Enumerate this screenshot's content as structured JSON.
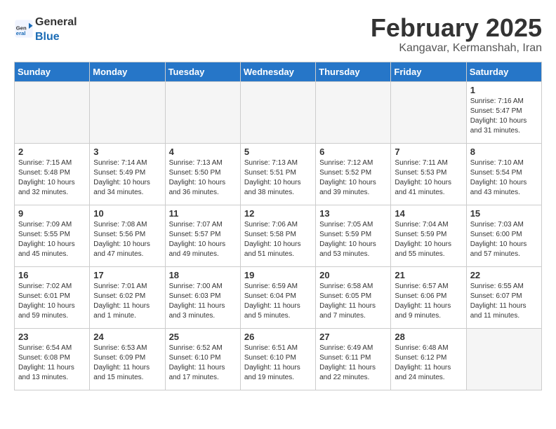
{
  "header": {
    "logo_general": "General",
    "logo_blue": "Blue",
    "month_year": "February 2025",
    "location": "Kangavar, Kermanshah, Iran"
  },
  "weekdays": [
    "Sunday",
    "Monday",
    "Tuesday",
    "Wednesday",
    "Thursday",
    "Friday",
    "Saturday"
  ],
  "weeks": [
    [
      {
        "day": "",
        "info": ""
      },
      {
        "day": "",
        "info": ""
      },
      {
        "day": "",
        "info": ""
      },
      {
        "day": "",
        "info": ""
      },
      {
        "day": "",
        "info": ""
      },
      {
        "day": "",
        "info": ""
      },
      {
        "day": "1",
        "info": "Sunrise: 7:16 AM\nSunset: 5:47 PM\nDaylight: 10 hours and 31 minutes."
      }
    ],
    [
      {
        "day": "2",
        "info": "Sunrise: 7:15 AM\nSunset: 5:48 PM\nDaylight: 10 hours and 32 minutes."
      },
      {
        "day": "3",
        "info": "Sunrise: 7:14 AM\nSunset: 5:49 PM\nDaylight: 10 hours and 34 minutes."
      },
      {
        "day": "4",
        "info": "Sunrise: 7:13 AM\nSunset: 5:50 PM\nDaylight: 10 hours and 36 minutes."
      },
      {
        "day": "5",
        "info": "Sunrise: 7:13 AM\nSunset: 5:51 PM\nDaylight: 10 hours and 38 minutes."
      },
      {
        "day": "6",
        "info": "Sunrise: 7:12 AM\nSunset: 5:52 PM\nDaylight: 10 hours and 39 minutes."
      },
      {
        "day": "7",
        "info": "Sunrise: 7:11 AM\nSunset: 5:53 PM\nDaylight: 10 hours and 41 minutes."
      },
      {
        "day": "8",
        "info": "Sunrise: 7:10 AM\nSunset: 5:54 PM\nDaylight: 10 hours and 43 minutes."
      }
    ],
    [
      {
        "day": "9",
        "info": "Sunrise: 7:09 AM\nSunset: 5:55 PM\nDaylight: 10 hours and 45 minutes."
      },
      {
        "day": "10",
        "info": "Sunrise: 7:08 AM\nSunset: 5:56 PM\nDaylight: 10 hours and 47 minutes."
      },
      {
        "day": "11",
        "info": "Sunrise: 7:07 AM\nSunset: 5:57 PM\nDaylight: 10 hours and 49 minutes."
      },
      {
        "day": "12",
        "info": "Sunrise: 7:06 AM\nSunset: 5:58 PM\nDaylight: 10 hours and 51 minutes."
      },
      {
        "day": "13",
        "info": "Sunrise: 7:05 AM\nSunset: 5:59 PM\nDaylight: 10 hours and 53 minutes."
      },
      {
        "day": "14",
        "info": "Sunrise: 7:04 AM\nSunset: 5:59 PM\nDaylight: 10 hours and 55 minutes."
      },
      {
        "day": "15",
        "info": "Sunrise: 7:03 AM\nSunset: 6:00 PM\nDaylight: 10 hours and 57 minutes."
      }
    ],
    [
      {
        "day": "16",
        "info": "Sunrise: 7:02 AM\nSunset: 6:01 PM\nDaylight: 10 hours and 59 minutes."
      },
      {
        "day": "17",
        "info": "Sunrise: 7:01 AM\nSunset: 6:02 PM\nDaylight: 11 hours and 1 minute."
      },
      {
        "day": "18",
        "info": "Sunrise: 7:00 AM\nSunset: 6:03 PM\nDaylight: 11 hours and 3 minutes."
      },
      {
        "day": "19",
        "info": "Sunrise: 6:59 AM\nSunset: 6:04 PM\nDaylight: 11 hours and 5 minutes."
      },
      {
        "day": "20",
        "info": "Sunrise: 6:58 AM\nSunset: 6:05 PM\nDaylight: 11 hours and 7 minutes."
      },
      {
        "day": "21",
        "info": "Sunrise: 6:57 AM\nSunset: 6:06 PM\nDaylight: 11 hours and 9 minutes."
      },
      {
        "day": "22",
        "info": "Sunrise: 6:55 AM\nSunset: 6:07 PM\nDaylight: 11 hours and 11 minutes."
      }
    ],
    [
      {
        "day": "23",
        "info": "Sunrise: 6:54 AM\nSunset: 6:08 PM\nDaylight: 11 hours and 13 minutes."
      },
      {
        "day": "24",
        "info": "Sunrise: 6:53 AM\nSunset: 6:09 PM\nDaylight: 11 hours and 15 minutes."
      },
      {
        "day": "25",
        "info": "Sunrise: 6:52 AM\nSunset: 6:10 PM\nDaylight: 11 hours and 17 minutes."
      },
      {
        "day": "26",
        "info": "Sunrise: 6:51 AM\nSunset: 6:10 PM\nDaylight: 11 hours and 19 minutes."
      },
      {
        "day": "27",
        "info": "Sunrise: 6:49 AM\nSunset: 6:11 PM\nDaylight: 11 hours and 22 minutes."
      },
      {
        "day": "28",
        "info": "Sunrise: 6:48 AM\nSunset: 6:12 PM\nDaylight: 11 hours and 24 minutes."
      },
      {
        "day": "",
        "info": ""
      }
    ]
  ]
}
